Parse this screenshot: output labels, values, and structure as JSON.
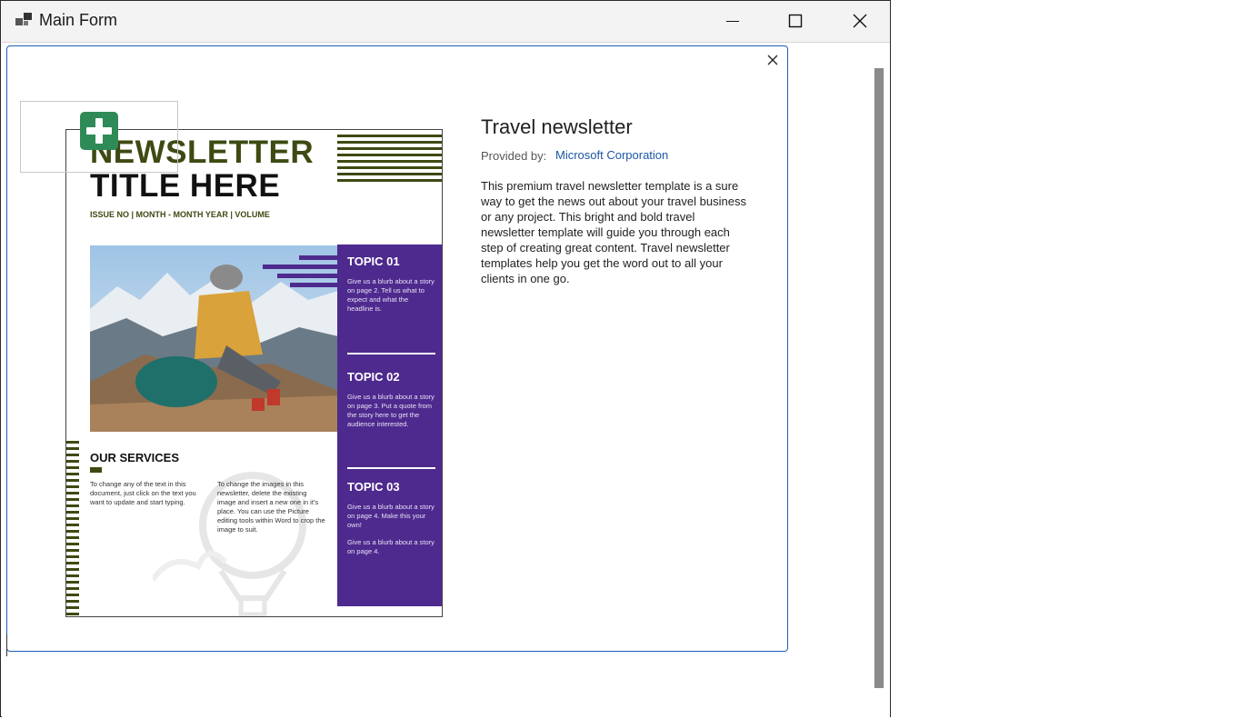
{
  "window": {
    "title": "Main Form",
    "minimize_icon": "minimize-icon",
    "maximize_icon": "maximize-icon",
    "close_icon": "close-icon"
  },
  "template": {
    "name": "Travel newsletter",
    "provided_by_label": "Provided by:",
    "provider": "Microsoft Corporation",
    "description": "This premium travel newsletter template is a sure way to get the news out about your travel business or any project. This bright and bold travel newsletter template will guide you through each step of creating great content. Travel newsletter templates help you get the word out to all your clients in one go."
  },
  "preview": {
    "title_line1": "NEWSLETTER",
    "title_line2": "TITLE HERE",
    "issue_line": "ISSUE NO  |  MONTH - MONTH YEAR  |  VOLUME",
    "topics": [
      {
        "title": "TOPIC 01",
        "blurb": "Give us a blurb about a story on page 2.  Tell us what to expect and what the headline is."
      },
      {
        "title": "TOPIC 02",
        "blurb": "Give us a blurb about a story on page 3.  Put a quote from the story here to get the audience interested."
      },
      {
        "title": "TOPIC 03",
        "blurb": "Give us a blurb about a story on page 4.  Make this your own!"
      }
    ],
    "topic3_extra": "Give us a blurb about a story on page 4.",
    "services_heading": "OUR SERVICES",
    "services_col1": "To change any of the text in this document, just click on the text you want to update and start typing.",
    "services_col2": "To change the images in this newsletter, delete the existing image and insert a new one in it's place. You can use the Picture editing tools within Word to crop the image to suit."
  },
  "colors": {
    "accent_olive": "#3d4a12",
    "accent_purple": "#4e2a8e",
    "link_blue": "#1b57a4",
    "add_badge_green": "#2e8b57"
  },
  "icons": {
    "add_badge": "plus-square-icon",
    "panel_close": "close-icon"
  }
}
